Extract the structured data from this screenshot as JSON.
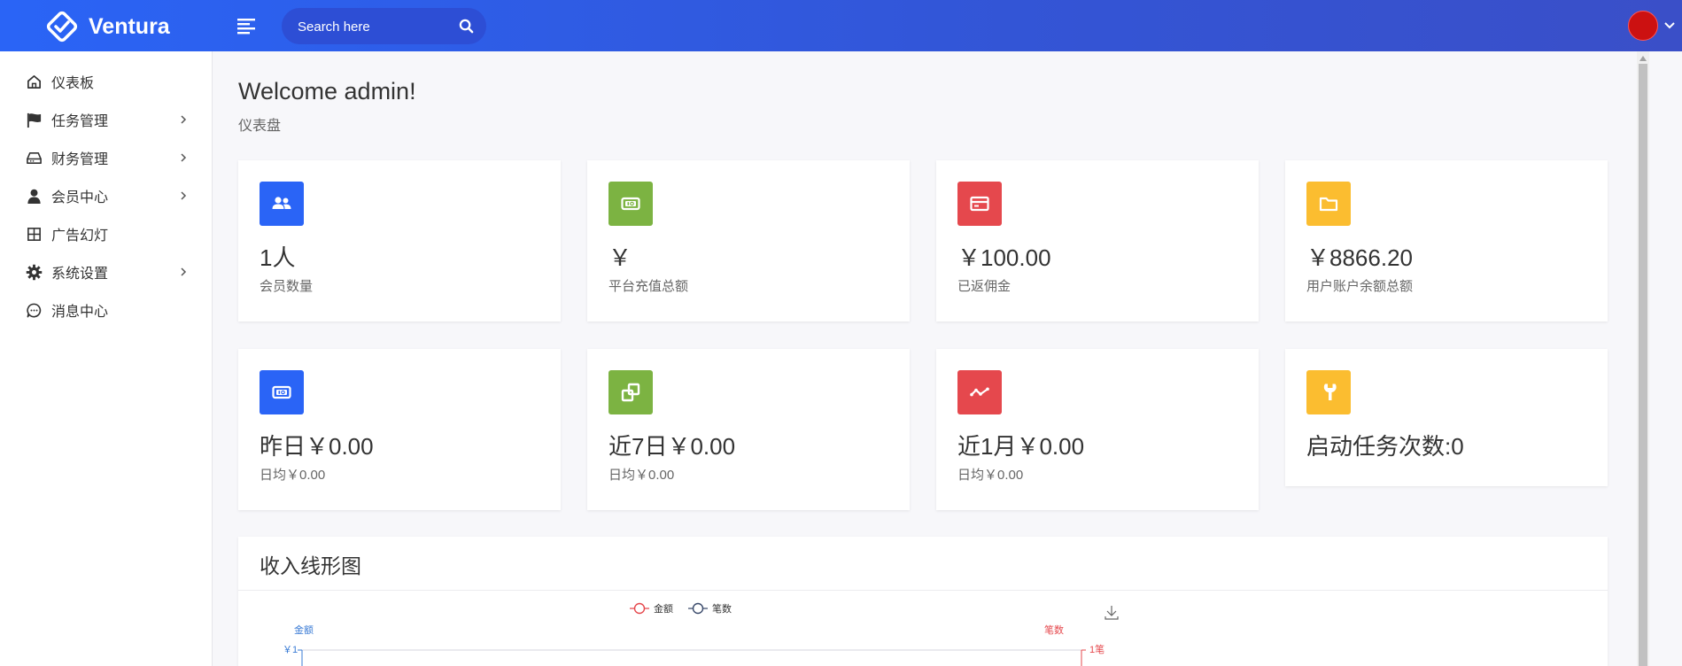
{
  "header": {
    "brand": "Ventura",
    "search_placeholder": "Search here"
  },
  "sidebar": {
    "items": [
      {
        "label": "仪表板",
        "icon": "home-icon"
      },
      {
        "label": "任务管理",
        "icon": "flag-icon",
        "expandable": true
      },
      {
        "label": "财务管理",
        "icon": "hard-drive-icon",
        "expandable": true
      },
      {
        "label": "会员中心",
        "icon": "user-icon",
        "expandable": true
      },
      {
        "label": "广告幻灯",
        "icon": "grid-icon"
      },
      {
        "label": "系统设置",
        "icon": "gear-icon",
        "expandable": true
      },
      {
        "label": "消息中心",
        "icon": "message-icon"
      }
    ]
  },
  "page": {
    "welcome": "Welcome admin!",
    "subtitle": "仪表盘"
  },
  "cards": [
    {
      "value": "1人",
      "label": "会员数量",
      "icon": "users-icon",
      "color": "#2a64f6"
    },
    {
      "value": "￥",
      "label": "平台充值总额",
      "icon": "money-icon",
      "color": "#7cb342"
    },
    {
      "value": "￥100.00",
      "label": "已返佣金",
      "icon": "credit-card-icon",
      "color": "#e5484d"
    },
    {
      "value": "￥8866.20",
      "label": "用户账户余额总额",
      "icon": "folder-icon",
      "color": "#fbbd30"
    },
    {
      "value": "昨日￥0.00",
      "label": "日均￥0.00",
      "icon": "money-icon",
      "color": "#2a64f6"
    },
    {
      "value": "近7日￥0.00",
      "label": "日均￥0.00",
      "icon": "copy-icon",
      "color": "#7cb342"
    },
    {
      "value": "近1月￥0.00",
      "label": "日均￥0.00",
      "icon": "activity-icon",
      "color": "#e5484d"
    },
    {
      "value": "启动任务次数:0",
      "label": "",
      "icon": "wrench-icon",
      "color": "#fbbd30"
    }
  ],
  "chart": {
    "title": "收入线形图",
    "legend_amount": "金额",
    "legend_count": "笔数",
    "left_axis_name": "金额",
    "right_axis_name": "笔数",
    "left_tick_top": "￥1",
    "right_tick_top": "1笔",
    "colors": {
      "amount": "#e5484d",
      "count": "#3a4a6b",
      "left_axis": "#3a7bd5",
      "right_axis": "#e5484d"
    }
  }
}
